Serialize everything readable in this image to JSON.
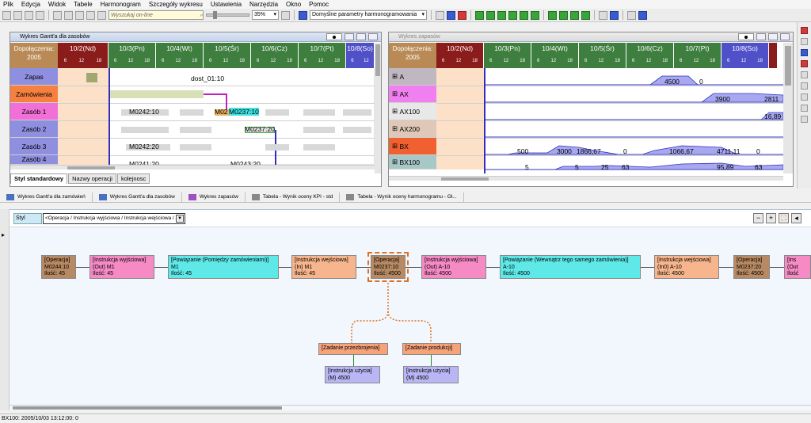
{
  "menu": [
    "Plik",
    "Edycja",
    "Widok",
    "Tabele",
    "Harmonogram",
    "Szczegóły wykresu",
    "Ustawienia",
    "Narzędzia",
    "Okno",
    "Pomoc"
  ],
  "toolbar": {
    "search_placeholder": "Wyszukaj on-line",
    "zoom": "35%",
    "params": "Domyślne parametry harmonogramowania"
  },
  "gantt_window": {
    "title": "Wykres Gantt'a dla zasobów",
    "corner": "Dopołączenia: 2005",
    "days": [
      "10/2(Nd)",
      "10/3(Pn)",
      "10/4(Wt)",
      "10/5(Śr)",
      "10/6(Cz)",
      "10/7(Pt)",
      "10/8(So)"
    ],
    "hours": [
      "6",
      "12",
      "18"
    ],
    "rows": [
      {
        "label": "Zapas",
        "color": "#8f8fe0"
      },
      {
        "label": "Zamówienia",
        "color": "#f58040"
      },
      {
        "label": "Zasób 1",
        "color": "#f070d8"
      },
      {
        "label": "Zasób 2",
        "color": "#8f8fe0"
      },
      {
        "label": "Zasób 3",
        "color": "#8f8fe0"
      },
      {
        "label": "Zasób 4",
        "color": "#8f8fe0"
      }
    ],
    "labels": {
      "dost": "dost_01:10",
      "m1": "M0242:10",
      "m2": "M02",
      "m3": "M0237:10",
      "m4": "M0237:20",
      "m5": "M0242:20",
      "m6": "M0241:20",
      "m7": "M0243:20"
    },
    "tabs": [
      "Styl standardowy",
      "Nazwy operacji",
      "kolejnosc"
    ]
  },
  "stock_window": {
    "title": "Wykres zapasów",
    "corner": "Dopołączenia: 2005",
    "days": [
      "10/2(Nd)",
      "10/3(Pn)",
      "10/4(Wt)",
      "10/5(Śr)",
      "10/6(Cz)",
      "10/7(Pt)",
      "10/8(So)"
    ],
    "rows": [
      {
        "label": "A",
        "color": "#c0b8c0"
      },
      {
        "label": "AX",
        "color": "#f080f0"
      },
      {
        "label": "AX100",
        "color": "#e8e8e8"
      },
      {
        "label": "AX200",
        "color": "#e0c8b8"
      },
      {
        "label": "BX",
        "color": "#f06030"
      },
      {
        "label": "BX100",
        "color": "#a8c8c8"
      }
    ],
    "values": {
      "a": [
        "4500",
        "0"
      ],
      "ax": [
        "3900",
        "2811"
      ],
      "ax100": [
        "16,89"
      ],
      "bx": [
        "500",
        "3000",
        "1866,67",
        "0",
        "1066,67",
        "4711,11",
        "0"
      ],
      "bx100": [
        "5",
        "5",
        "25",
        "63",
        "95,89",
        "63"
      ]
    }
  },
  "taskbar": [
    "Wykres Gantt'a dla zamówień",
    "Wykres Gantt'a dla zasobów",
    "Wykres zapasów",
    "Tabela - Wynik oceny KPI - std",
    "Tabela - Wynik oceny harmonogramu - Gł..."
  ],
  "diagram": {
    "style_label": "Styl",
    "style_value": "<Operacja / Instrukcja wyjściowa / Instrukcja wejściowa / Z",
    "nodes": {
      "n1": [
        "[Operacja]",
        "M0244:10",
        "Ilość: 45"
      ],
      "n2": [
        "[Instrukcja wyjściowa]",
        "(Out) M1",
        "Ilość: 45"
      ],
      "n3": [
        "[Powiązanie (Pomiędzy zamówieniami)]",
        "M1",
        "Ilość: 45"
      ],
      "n4": [
        "[Instrukcja wejściowa]",
        "(In) M1",
        "Ilość: 45"
      ],
      "n5": [
        "[Operacja]",
        "M0237:10",
        "Ilość: 4500"
      ],
      "n6": [
        "[Instrukcja wyjściowa]",
        "(Out) A-10",
        "Ilość: 4500"
      ],
      "n7": [
        "[Powiązanie (Wewnątrz tego samego zamówienia)]",
        "A-10",
        "Ilość: 4500"
      ],
      "n8": [
        "[Instrukcja wejściowa]",
        "(In0) A-10",
        "Ilość: 4500"
      ],
      "n9": [
        "[Operacja]",
        "M0237:20",
        "Ilość: 4500"
      ],
      "n10": [
        "[Ins",
        "(Out",
        "Ilość"
      ],
      "z1": [
        "[Zadanie przezbrojenia]"
      ],
      "z2": [
        "[Zadanie produkcji]"
      ],
      "u1": [
        "[Instrukcja użycia]",
        "(M) 4500"
      ],
      "u2": [
        "[Instrukcja użycia]",
        "(M) 4500"
      ]
    }
  },
  "status": "BX100: 2005/10/03 13:12:00: 0"
}
